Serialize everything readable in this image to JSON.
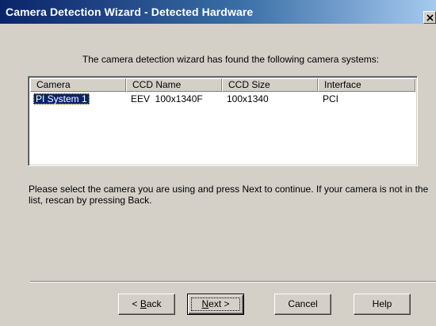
{
  "window": {
    "title": "Camera Detection Wizard - Detected Hardware",
    "close_glyph": "×"
  },
  "intro_text": "The camera detection wizard has found the following camera systems:",
  "camera_list": {
    "columns": [
      "Camera",
      "CCD Name",
      "CCD Size",
      "Interface"
    ],
    "rows": [
      {
        "camera": "PI System 1",
        "ccd_name": "EEV  100x1340F",
        "ccd_size": "100x1340",
        "interface": "PCI",
        "selected": true
      }
    ]
  },
  "instructions": "Please select the camera you are using and press Next to continue. If your camera is not in the list, rescan by pressing Back.",
  "buttons": {
    "back": {
      "prefix": "< ",
      "mnemonic": "B",
      "rest": "ack"
    },
    "next": {
      "mnemonic": "N",
      "rest": "ext >"
    },
    "cancel": "Cancel",
    "help": "Help"
  },
  "colors": {
    "title_bar_start": "#0a246a",
    "title_bar_end": "#a6caf0",
    "face": "#d4d0c8",
    "selection": "#0a246a"
  }
}
